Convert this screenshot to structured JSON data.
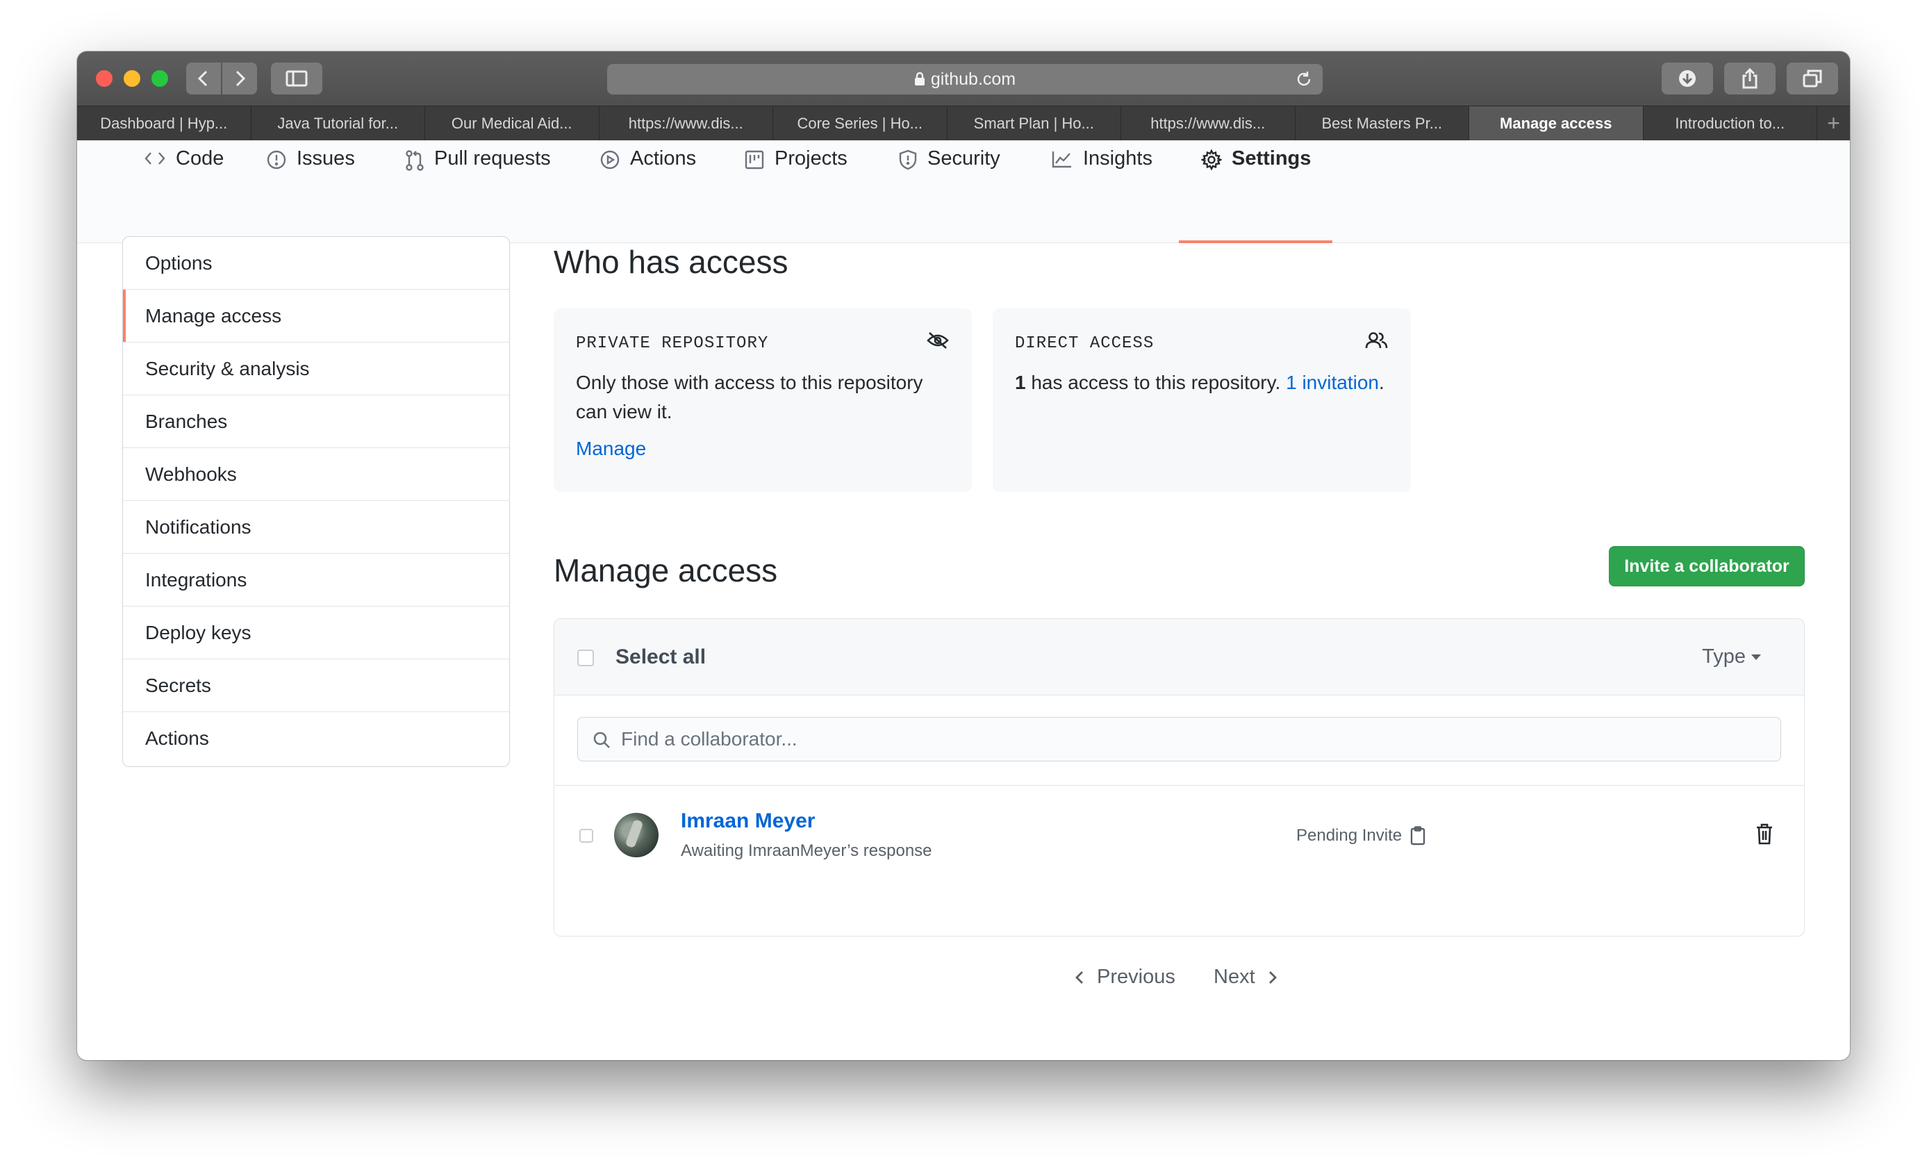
{
  "browser": {
    "address": "github.com",
    "tabs": [
      {
        "label": "Dashboard | Hyp...",
        "active": false
      },
      {
        "label": "Java Tutorial for...",
        "active": false
      },
      {
        "label": "Our Medical Aid...",
        "active": false
      },
      {
        "label": "https://www.dis...",
        "active": false
      },
      {
        "label": "Core Series | Ho...",
        "active": false
      },
      {
        "label": "Smart Plan | Ho...",
        "active": false
      },
      {
        "label": "https://www.dis...",
        "active": false
      },
      {
        "label": "Best Masters Pr...",
        "active": false
      },
      {
        "label": "Manage access",
        "active": true
      },
      {
        "label": "Introduction to...",
        "active": false
      }
    ],
    "new_tab": "+"
  },
  "repo_nav": {
    "items": [
      {
        "label": "Code",
        "icon": "code-icon"
      },
      {
        "label": "Issues",
        "icon": "issue-icon"
      },
      {
        "label": "Pull requests",
        "icon": "pull-request-icon"
      },
      {
        "label": "Actions",
        "icon": "play-icon"
      },
      {
        "label": "Projects",
        "icon": "project-icon"
      },
      {
        "label": "Security",
        "icon": "shield-icon"
      },
      {
        "label": "Insights",
        "icon": "graph-icon"
      },
      {
        "label": "Settings",
        "icon": "gear-icon",
        "selected": true
      }
    ],
    "accent": "#f9826c"
  },
  "settings_menu": {
    "items": [
      {
        "label": "Options"
      },
      {
        "label": "Manage access",
        "selected": true
      },
      {
        "label": "Security & analysis"
      },
      {
        "label": "Branches"
      },
      {
        "label": "Webhooks"
      },
      {
        "label": "Notifications"
      },
      {
        "label": "Integrations"
      },
      {
        "label": "Deploy keys"
      },
      {
        "label": "Secrets"
      },
      {
        "label": "Actions"
      }
    ]
  },
  "who_has_access": {
    "title": "Who has access",
    "private_card": {
      "heading": "PRIVATE REPOSITORY",
      "icon": "eye-closed-icon",
      "body": "Only those with access to this repository can view it.",
      "link": "Manage"
    },
    "direct_card": {
      "heading": "DIRECT ACCESS",
      "icon": "people-icon",
      "count": "1",
      "body_text": " has access to this repository. ",
      "invitation_link": "1 invitation",
      "trailing": "."
    }
  },
  "manage_access": {
    "title": "Manage access",
    "invite_button": "Invite a collaborator",
    "select_all": "Select all",
    "type_filter": "Type",
    "search_placeholder": "Find a collaborator...",
    "members": [
      {
        "name": "Imraan Meyer",
        "subtitle": "Awaiting ImraanMeyer’s response",
        "status": "Pending Invite"
      }
    ]
  },
  "pagination": {
    "previous": "Previous",
    "next": "Next"
  },
  "colors": {
    "primary_button": "#2ea44f",
    "link": "#0366d6",
    "selected_indicator": "#f9826c"
  }
}
